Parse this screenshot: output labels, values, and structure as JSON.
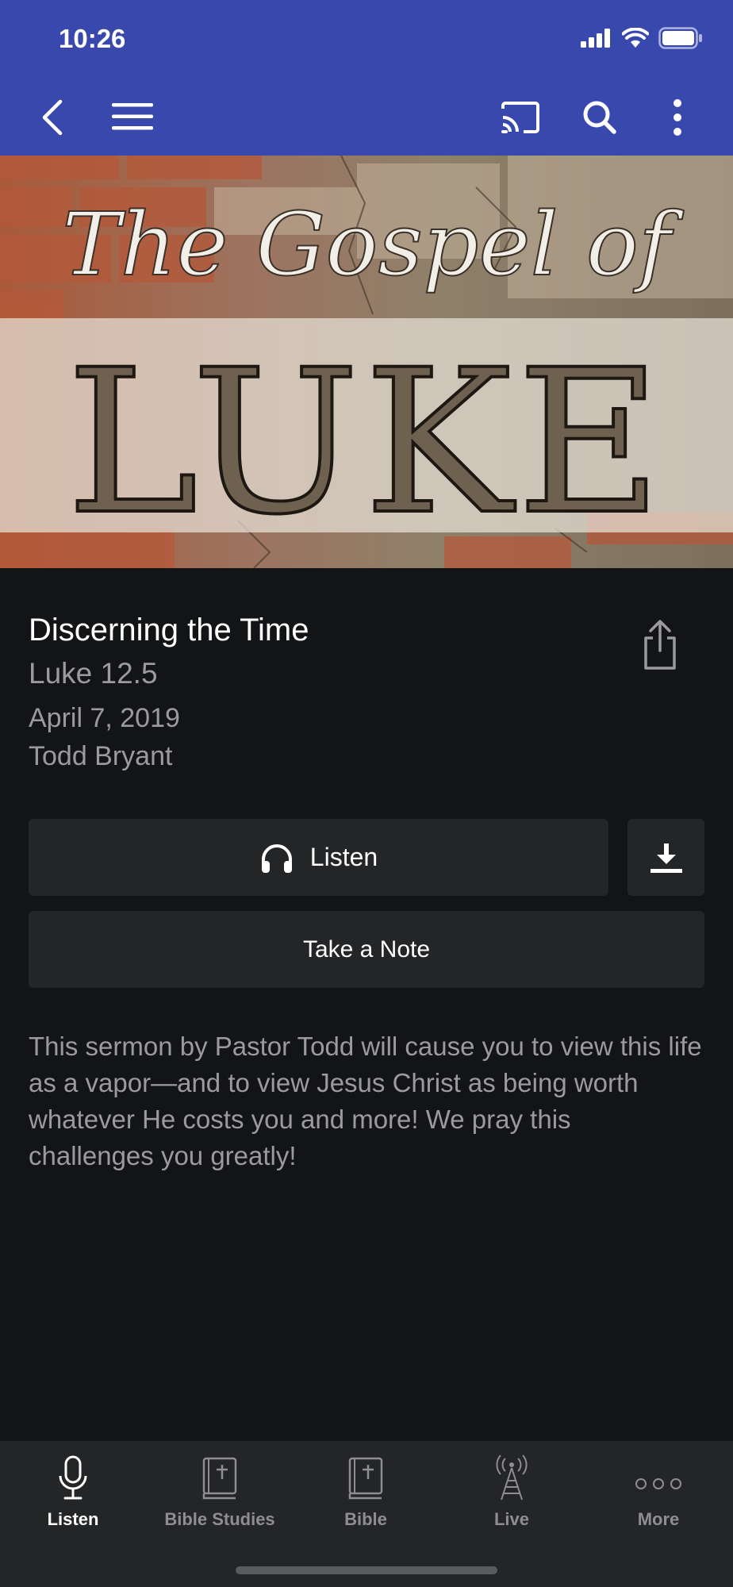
{
  "status_bar": {
    "time": "10:26"
  },
  "toolbar": {
    "back_icon": "chevron-left-icon",
    "menu_icon": "hamburger-menu-icon",
    "cast_icon": "cast-icon",
    "search_icon": "search-icon",
    "more_icon": "more-vertical-icon"
  },
  "hero": {
    "script_line": "The Gospel of",
    "headline": "LUKE"
  },
  "sermon": {
    "title": "Discerning the Time",
    "scripture": "Luke 12.5",
    "date": "April 7, 2019",
    "speaker": "Todd Bryant",
    "description": "This sermon by Pastor Todd will cause you to view this life as a vapor—and to view Jesus Christ as being worth whatever He costs you and more! We pray this challenges you greatly!"
  },
  "actions": {
    "listen_label": "Listen",
    "note_label": "Take a Note"
  },
  "tabs": [
    {
      "label": "Listen",
      "icon": "microphone-icon",
      "active": true
    },
    {
      "label": "Bible Studies",
      "icon": "bible-icon",
      "active": false
    },
    {
      "label": "Bible",
      "icon": "bible-icon",
      "active": false
    },
    {
      "label": "Live",
      "icon": "broadcast-tower-icon",
      "active": false
    },
    {
      "label": "More",
      "icon": "more-dots-icon",
      "active": false
    }
  ],
  "colors": {
    "header": "#3948ad",
    "background": "#131416",
    "button": "#242527",
    "muted_text": "#9b9b9f"
  }
}
